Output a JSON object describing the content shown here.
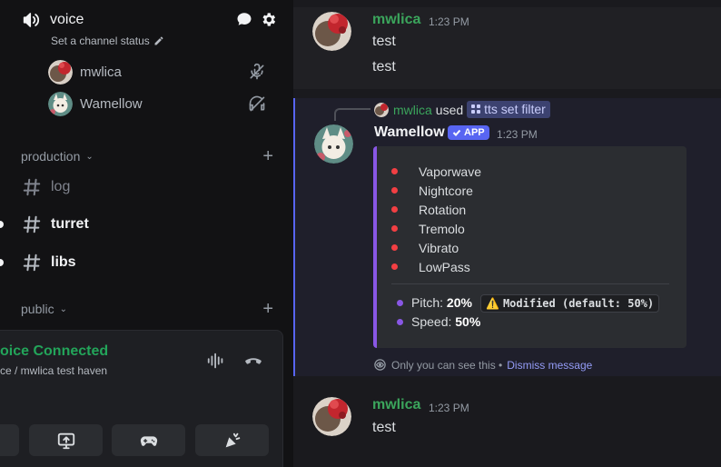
{
  "sidebar": {
    "voice_channel": {
      "name": "voice",
      "status_placeholder": "Set a channel status"
    },
    "voice_users": [
      {
        "name": "mwlica"
      },
      {
        "name": "Wamellow"
      }
    ],
    "categories": [
      {
        "name": "production",
        "channels": [
          {
            "name": "log",
            "unread": false
          },
          {
            "name": "turret",
            "unread": true
          },
          {
            "name": "libs",
            "unread": true
          }
        ]
      },
      {
        "name": "public",
        "channels": []
      }
    ],
    "voice_panel": {
      "status": "oice Connected",
      "location": "ce / mwlica test haven"
    }
  },
  "chat": {
    "messages": [
      {
        "author": "mwlica",
        "time": "1:23 PM",
        "lines": [
          "test",
          "test"
        ]
      },
      {
        "author": "Wamellow",
        "badge": "APP",
        "time": "1:23 PM",
        "reply": {
          "user": "mwlica",
          "action": "used",
          "command": "tts set filter"
        },
        "embed": {
          "filters": [
            "Vaporwave",
            "Nightcore",
            "Rotation",
            "Tremolo",
            "Vibrato",
            "LowPass"
          ],
          "pitch_label": "Pitch:",
          "pitch_value": "20%",
          "pitch_note": "Modified (default: 50%)",
          "speed_label": "Speed:",
          "speed_value": "50%"
        },
        "ephemeral_note": "Only you can see this •",
        "dismiss_label": "Dismiss message"
      },
      {
        "author": "mwlica",
        "time": "1:23 PM",
        "lines": [
          "test"
        ]
      }
    ]
  },
  "colors": {
    "user_green": "#3ba55c",
    "app_badge": "#5865f2",
    "embed_accent": "#8957e5",
    "filter_dot": "#f23f43",
    "connected": "#23a55a"
  }
}
